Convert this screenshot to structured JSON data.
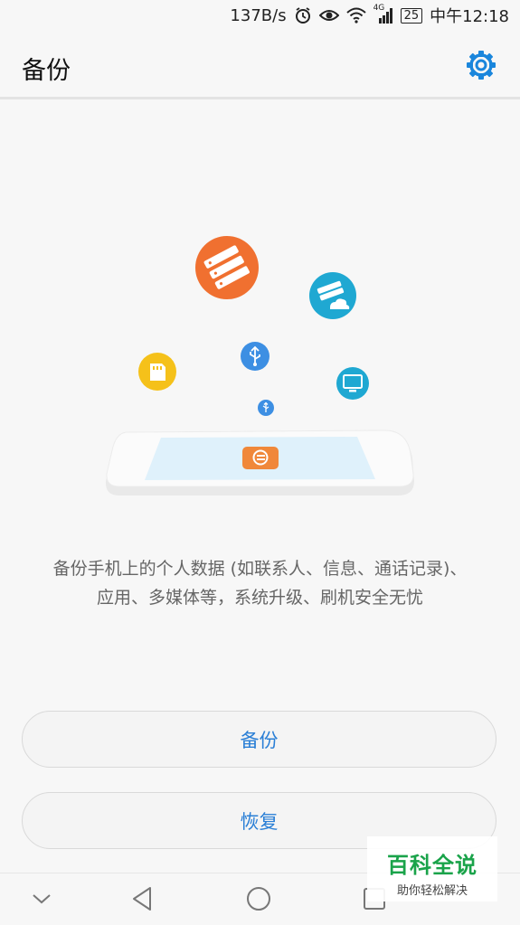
{
  "status_bar": {
    "net_speed": "137B/s",
    "network_type": "4G",
    "battery": "25",
    "time": "中午12:18",
    "icons": [
      "alarm-icon",
      "eye-icon",
      "wifi-icon",
      "signal-icon",
      "battery-icon"
    ]
  },
  "app_bar": {
    "title": "备份",
    "settings_icon": "gear-icon",
    "accent": "#1a86dc"
  },
  "illustration": {
    "icons": [
      "server-icon",
      "cloud-server-icon",
      "sd-card-icon",
      "usb-icon",
      "monitor-icon",
      "usb-small-icon",
      "backup-app-icon"
    ],
    "colors": {
      "orange": "#f07030",
      "teal": "#1fa8d2",
      "yellow": "#f5c11a",
      "blue": "#3d8fe3",
      "screen": "#dff1fb"
    }
  },
  "description": {
    "line1": "备份手机上的个人数据 (如联系人、信息、通话记录)、",
    "line2": "应用、多媒体等，系统升级、刷机安全无忧"
  },
  "buttons": {
    "backup": "备份",
    "restore": "恢复"
  },
  "nav_bar": {
    "icons": [
      "chevron-down-icon",
      "back-icon",
      "home-icon",
      "recents-icon"
    ]
  },
  "watermark": {
    "line1": "百科全说",
    "line2": "助你轻松解决"
  }
}
